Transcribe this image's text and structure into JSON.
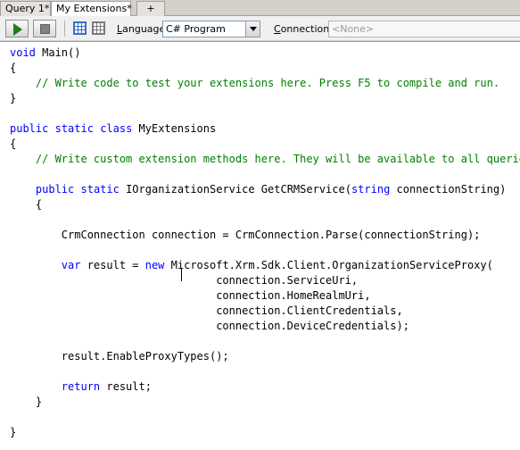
{
  "tabs": [
    {
      "label": "Query 1*",
      "active": false
    },
    {
      "label": "My Extensions*",
      "active": true
    },
    {
      "label": "+",
      "active": false
    }
  ],
  "toolbar": {
    "run_icon": "play-icon",
    "stop_icon": "stop-icon",
    "language_label": "Language",
    "language_value": "C# Program",
    "connection_label": "Connection",
    "connection_value": "<None>"
  },
  "colors": {
    "keyword": "#0000ff",
    "comment": "#008000",
    "text": "#000000",
    "run_green": "#1e7e1e"
  },
  "editor": {
    "lines": [
      [
        {
          "t": "void",
          "c": "kw"
        },
        {
          "t": " Main()"
        }
      ],
      [
        {
          "t": "{"
        }
      ],
      [
        {
          "t": "    "
        },
        {
          "t": "// Write code to test your extensions here. Press F5 to compile and run.",
          "c": "cm"
        }
      ],
      [
        {
          "t": "}"
        }
      ],
      [],
      [
        {
          "t": "public",
          "c": "kw"
        },
        {
          "t": " "
        },
        {
          "t": "static",
          "c": "kw"
        },
        {
          "t": " "
        },
        {
          "t": "class",
          "c": "kw"
        },
        {
          "t": " MyExtensions"
        }
      ],
      [
        {
          "t": "{"
        }
      ],
      [
        {
          "t": "    "
        },
        {
          "t": "// Write custom extension methods here. They will be available to all queries.",
          "c": "cm"
        }
      ],
      [],
      [
        {
          "t": "    "
        },
        {
          "t": "public",
          "c": "kw"
        },
        {
          "t": " "
        },
        {
          "t": "static",
          "c": "kw"
        },
        {
          "t": " IOrganizationService GetCRMService("
        },
        {
          "t": "string",
          "c": "kw"
        },
        {
          "t": " connectionString)"
        }
      ],
      [
        {
          "t": "    {"
        }
      ],
      [],
      [
        {
          "t": "        CrmConnection connection = CrmConnection.Parse(connectionString);"
        }
      ],
      [],
      [
        {
          "t": "        "
        },
        {
          "t": "var",
          "c": "kw"
        },
        {
          "t": " result = "
        },
        {
          "t": "new",
          "c": "kw"
        },
        {
          "t": " Microsoft.Xrm.Sdk.Client.OrganizationServiceProxy("
        }
      ],
      [
        {
          "t": "                                connection.ServiceUri,"
        }
      ],
      [
        {
          "t": "                                connection.HomeRealmUri,"
        }
      ],
      [
        {
          "t": "                                connection.ClientCredentials,"
        }
      ],
      [
        {
          "t": "                                connection.DeviceCredentials);"
        }
      ],
      [],
      [
        {
          "t": "        result.EnableProxyTypes();"
        }
      ],
      [],
      [
        {
          "t": "        "
        },
        {
          "t": "return",
          "c": "kw"
        },
        {
          "t": " result;"
        }
      ],
      [
        {
          "t": "    }"
        }
      ],
      [],
      [
        {
          "t": "}"
        }
      ]
    ]
  }
}
